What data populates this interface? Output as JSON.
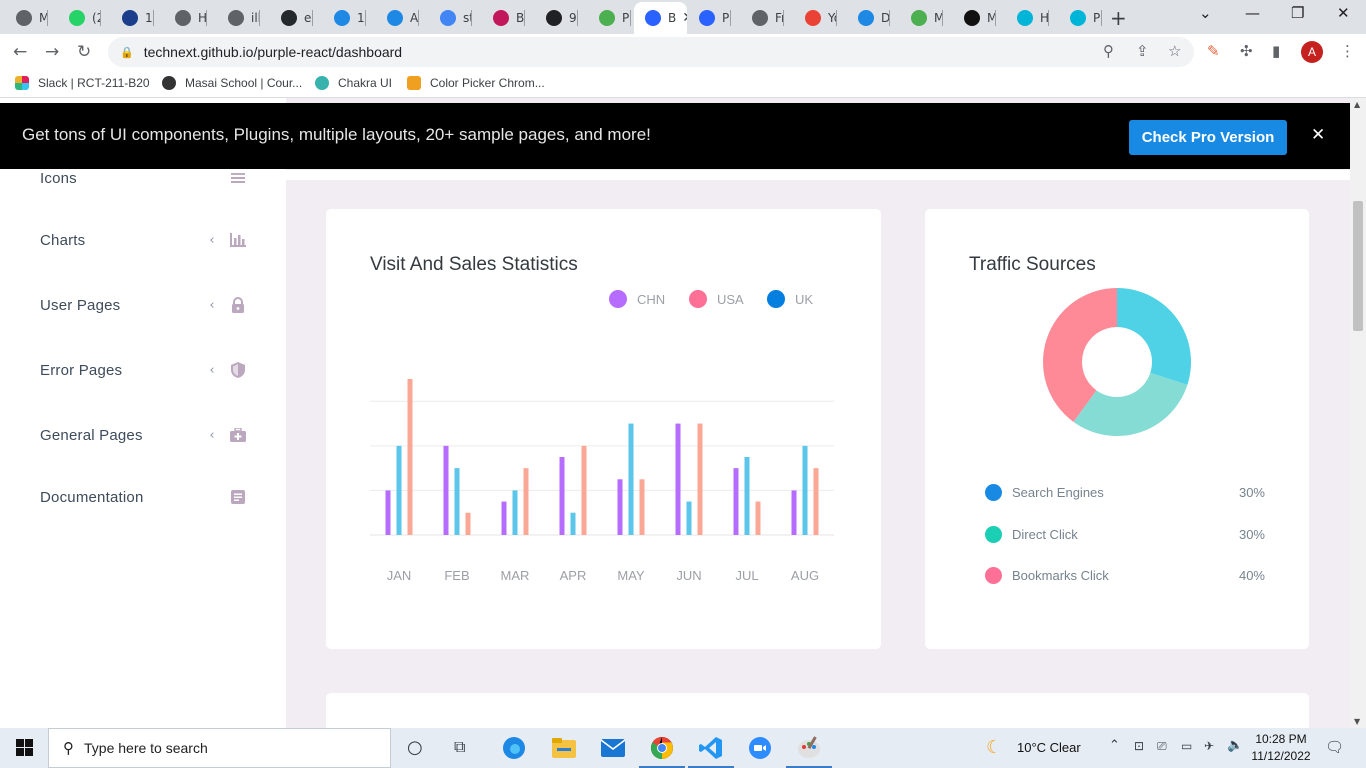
{
  "browser": {
    "tabs": [
      {
        "title": "M",
        "color": "#5f6368"
      },
      {
        "title": "(2)",
        "color": "#25d366"
      },
      {
        "title": "16",
        "color": "#1a3e8c"
      },
      {
        "title": "HI",
        "color": "#5f6368"
      },
      {
        "title": "illu",
        "color": "#5f6368"
      },
      {
        "title": "ele",
        "color": "#24292e"
      },
      {
        "title": "10",
        "color": "#1e88e5"
      },
      {
        "title": "Ap",
        "color": "#1e88e5"
      },
      {
        "title": "sta",
        "color": "#4285f4"
      },
      {
        "title": "Be",
        "color": "#c2185b"
      },
      {
        "title": "93",
        "color": "#202124"
      },
      {
        "title": "Pu",
        "color": "#4caf50"
      },
      {
        "title": "B",
        "color": "#2962ff"
      },
      {
        "title": "Pu",
        "color": "#2962ff"
      },
      {
        "title": "Fr",
        "color": "#5f6368"
      },
      {
        "title": "Yo",
        "color": "#ea4335"
      },
      {
        "title": "Dc",
        "color": "#1e88e5"
      },
      {
        "title": "M",
        "color": "#4caf50"
      },
      {
        "title": "M",
        "color": "#111111"
      },
      {
        "title": "Ho",
        "color": "#00b5d8"
      },
      {
        "title": "Pu",
        "color": "#00b5d8"
      }
    ],
    "url": "technext.github.io/purple-react/dashboard",
    "profile_initial": "A",
    "bookmarks": [
      {
        "label": "Slack | RCT-211-B20",
        "color": "#e01e5a"
      },
      {
        "label": "Masai School | Cour...",
        "color": "#333333"
      },
      {
        "label": "Chakra UI",
        "color": "#38b2ac"
      },
      {
        "label": "Color Picker Chrom...",
        "color": "#f0a020"
      }
    ]
  },
  "banner": {
    "text": "Get tons of UI components, Plugins, multiple layouts, 20+ sample pages, and more!",
    "button": "Check Pro Version",
    "close": "✕"
  },
  "sidebar": {
    "items": [
      {
        "label": "Icons",
        "icon": "menu-icon"
      },
      {
        "label": "Charts",
        "icon": "bar-chart-icon"
      },
      {
        "label": "User Pages",
        "icon": "lock-icon"
      },
      {
        "label": "Error Pages",
        "icon": "shield-icon"
      },
      {
        "label": "General Pages",
        "icon": "medical-bag-icon"
      },
      {
        "label": "Documentation",
        "icon": "document-icon"
      }
    ]
  },
  "visit_card": {
    "title": "Visit And Sales Statistics"
  },
  "traffic_card": {
    "title": "Traffic Sources",
    "sources": [
      {
        "name": "Search Engines",
        "pct": "30%",
        "color": "#198ae3"
      },
      {
        "name": "Direct Click",
        "pct": "30%",
        "color": "#1bcfb4"
      },
      {
        "name": "Bookmarks Click",
        "pct": "40%",
        "color": "#fe7096"
      }
    ]
  },
  "chart_data": [
    {
      "type": "bar",
      "categories": [
        "JAN",
        "FEB",
        "MAR",
        "APR",
        "MAY",
        "JUN",
        "JUL",
        "AUG"
      ],
      "series": [
        {
          "name": "CHN",
          "color": "#b66dff",
          "values": [
            20,
            40,
            15,
            35,
            25,
            50,
            30,
            20
          ]
        },
        {
          "name": "USA",
          "color": "#fe7096",
          "values": [
            40,
            30,
            20,
            10,
            50,
            15,
            35,
            40
          ]
        },
        {
          "name": "UK",
          "color": "#047edf",
          "values": [
            70,
            10,
            30,
            40,
            25,
            50,
            15,
            30
          ]
        }
      ],
      "legend_position": "top-right",
      "grid": true
    },
    {
      "type": "pie",
      "labels": [
        "Search Engines",
        "Direct Click",
        "Bookmarks Click"
      ],
      "values": [
        30,
        30,
        40
      ],
      "colors": [
        "#4fd1e6",
        "#84dcd4",
        "#fe8a98"
      ],
      "donut": true
    }
  ],
  "taskbar": {
    "search_placeholder": "Type here to search",
    "weather": "10°C  Clear",
    "time": "10:28 PM",
    "date": "11/12/2022"
  }
}
